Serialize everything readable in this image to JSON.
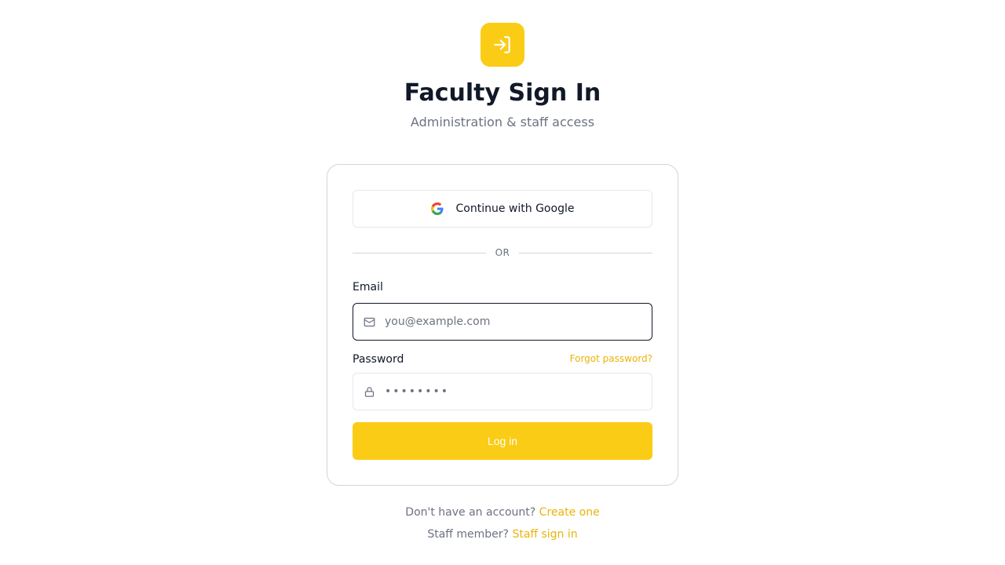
{
  "header": {
    "logo_icon": "sign-in-arrow-icon",
    "title": "Faculty Sign In",
    "subtitle": "Administration & staff access"
  },
  "card": {
    "google_button_label": "Continue with Google",
    "divider_text": "OR",
    "email": {
      "label": "Email",
      "placeholder": "you@example.com",
      "value": "",
      "icon": "mail-icon"
    },
    "password": {
      "label": "Password",
      "forgot_link": "Forgot password?",
      "value": "••••••••",
      "icon": "lock-icon"
    },
    "login_button_label": "Log in"
  },
  "footer": {
    "signup_prompt": "Don't have an account?",
    "signup_link": "Create one",
    "staff_prompt": "Staff member?",
    "staff_link": "Staff sign in"
  },
  "colors": {
    "accent": "#facc15",
    "link": "#eab308",
    "text": "#111827",
    "muted": "#6b7280"
  }
}
